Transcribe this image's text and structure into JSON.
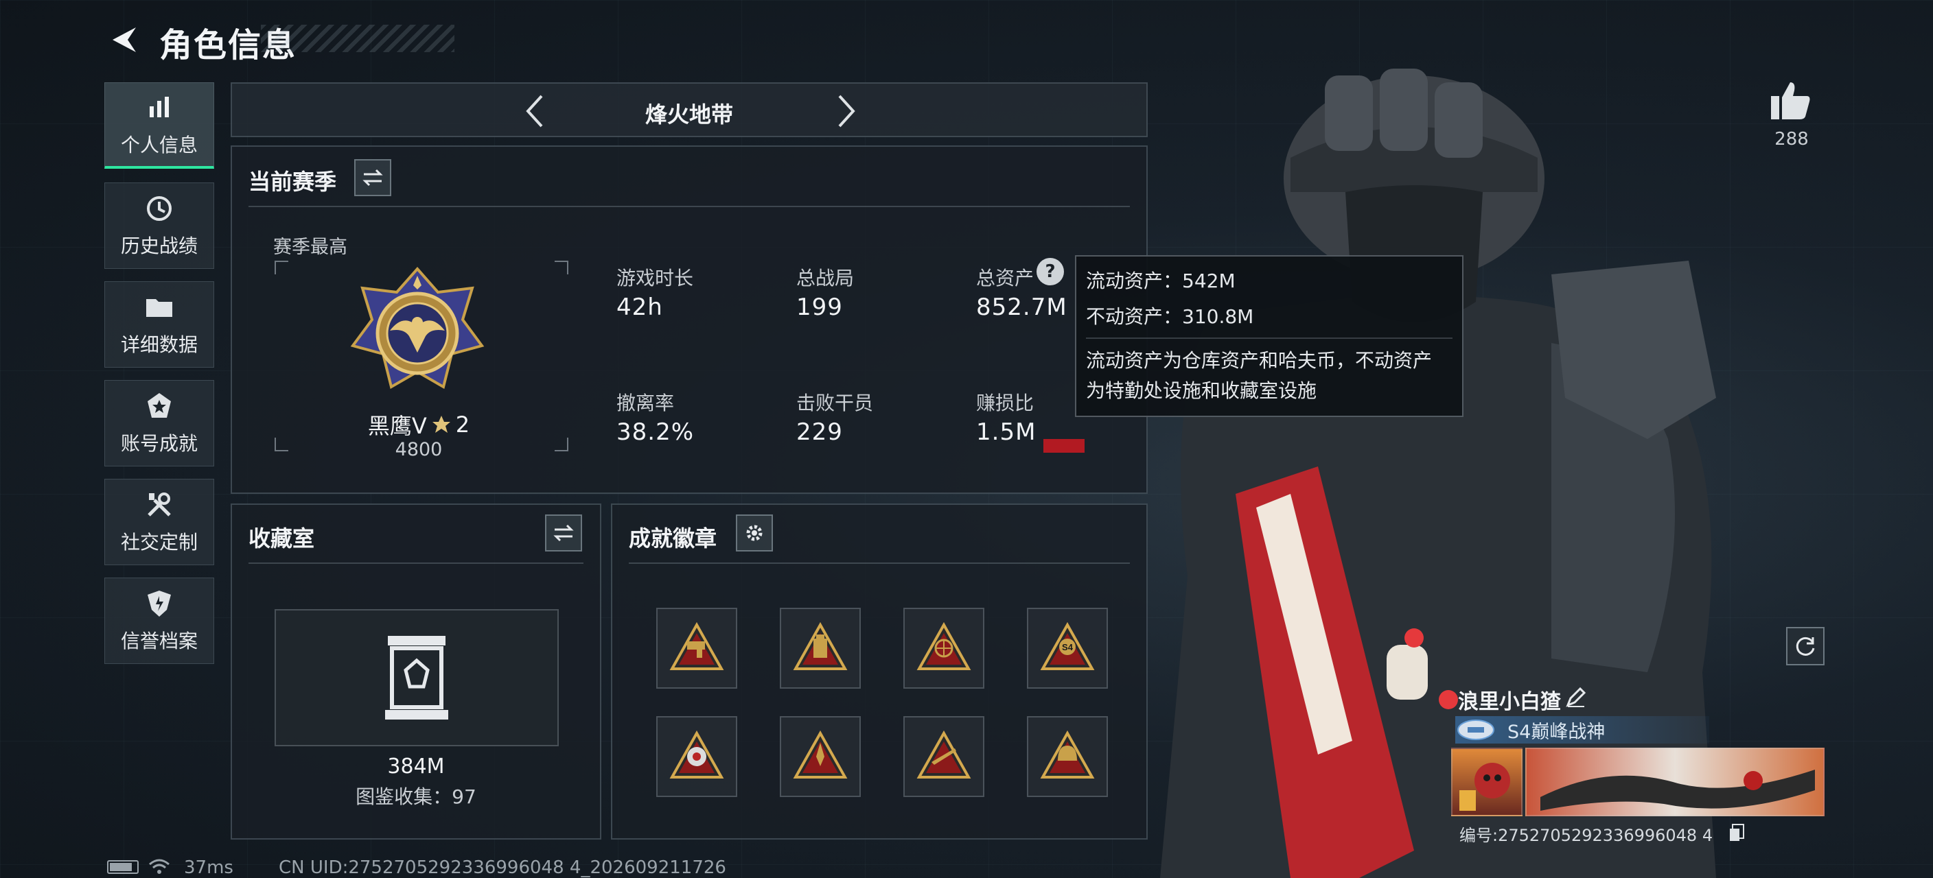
{
  "header": {
    "title": "角色信息"
  },
  "nav": {
    "items": [
      {
        "label": "个人信息",
        "icon": "bar-chart-icon",
        "active": true
      },
      {
        "label": "历史战绩",
        "icon": "history-clock-icon",
        "active": false
      },
      {
        "label": "详细数据",
        "icon": "folder-icon",
        "active": false
      },
      {
        "label": "账号成就",
        "icon": "achievement-star-icon",
        "active": false
      },
      {
        "label": "社交定制",
        "icon": "tools-icon",
        "active": false
      },
      {
        "label": "信誉档案",
        "icon": "credit-shield-icon",
        "active": false
      }
    ]
  },
  "mode": {
    "name": "烽火地带"
  },
  "season": {
    "title": "当前赛季",
    "best_label": "赛季最高",
    "rank_name": "黑鹰V",
    "rank_stars": "2",
    "rank_score": "4800",
    "stats": [
      {
        "label": "游戏时长",
        "value": "42h"
      },
      {
        "label": "总战局",
        "value": "199"
      },
      {
        "label": "总资产",
        "value": "852.7M"
      },
      {
        "label": "撤离率",
        "value": "38.2%"
      },
      {
        "label": "击败干员",
        "value": "229"
      },
      {
        "label": "赚损比",
        "value": "1.5M"
      }
    ]
  },
  "tooltip": {
    "liquid": "流动资产：542M",
    "fixed": "不动资产：310.8M",
    "desc_line1": "流动资产为仓库资产和哈夫币，不动资产",
    "desc_line2": "为特勤处设施和收藏室设施"
  },
  "collection": {
    "title": "收藏室",
    "value": "384M",
    "gallery": "图鉴收集：97"
  },
  "badges": {
    "title": "成就徽章",
    "items": [
      {
        "icon": "pistol-badge-icon"
      },
      {
        "icon": "vest-badge-icon"
      },
      {
        "icon": "target-badge-icon"
      },
      {
        "icon": "s4-badge-icon",
        "text": "S4"
      },
      {
        "icon": "gear-badge-icon"
      },
      {
        "icon": "rocket-badge-icon"
      },
      {
        "icon": "rifle-badge-icon"
      },
      {
        "icon": "helmet-badge-icon"
      }
    ]
  },
  "likes": {
    "count": "288"
  },
  "player": {
    "name": "浪里小白猹",
    "title": "S4巅峰战神",
    "uid_label": "编号:2752705292336996048 4"
  },
  "status": {
    "ping": "37ms",
    "uid": "CN UID:2752705292336996048 4_202609211726"
  },
  "colors": {
    "accent": "#2ee6a0",
    "gold": "#c9a14a",
    "panel": "#181f26"
  }
}
